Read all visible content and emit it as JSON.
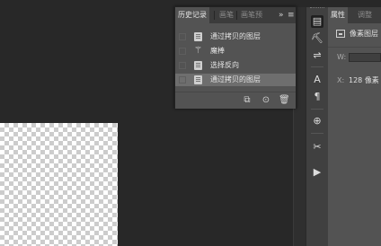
{
  "history_panel": {
    "tabs": [
      "历史记录",
      "画笔",
      "画笔预"
    ],
    "overflow_label": "»",
    "menu_label": "≡",
    "items": [
      {
        "label": "通过拷贝的图层",
        "icon": "document-icon",
        "selected": false
      },
      {
        "label": "魔棒",
        "icon": "magic-wand-icon",
        "selected": false
      },
      {
        "label": "选择反向",
        "icon": "document-icon",
        "selected": false
      },
      {
        "label": "通过拷贝的图层",
        "icon": "document-icon",
        "selected": true
      }
    ],
    "footer": {
      "new_document_glyph": "⧉",
      "snapshot_glyph": "⊙",
      "delete_glyph": "🗑"
    }
  },
  "tool_strip": {
    "tools": [
      {
        "name": "history-panel-icon",
        "glyph": "▤",
        "active": true
      },
      {
        "name": "brush-presets-icon",
        "glyph": "⛏",
        "active": false
      },
      {
        "name": "adjustments-icon",
        "glyph": "⇌",
        "active": false
      },
      {
        "name": "character-icon",
        "glyph": "A",
        "active": false
      },
      {
        "name": "paragraph-icon",
        "glyph": "¶",
        "active": false
      },
      {
        "name": "clone-source-icon",
        "glyph": "⊕",
        "active": false
      },
      {
        "name": "tool-presets-icon",
        "glyph": "✂",
        "active": false
      },
      {
        "name": "actions-play-icon",
        "glyph": "▶",
        "active": false
      }
    ]
  },
  "properties_panel": {
    "tabs": [
      "属性",
      "调整"
    ],
    "header": "像素图层",
    "w_label": "W:",
    "x_label": "X:",
    "x_value": "128 像素"
  },
  "colors": {
    "background": "#282828",
    "panel": "#535353",
    "tab_bar": "#3c3c3c",
    "selected_row": "#6e6e6e"
  }
}
